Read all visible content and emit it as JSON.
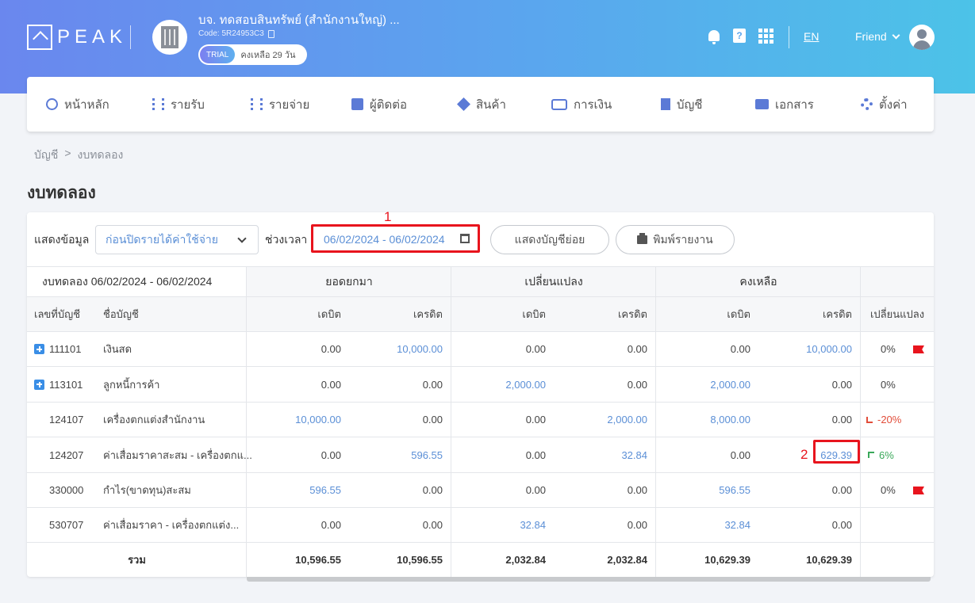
{
  "header": {
    "logo_text": "PEAK",
    "company_name": "บจ. ทดสอบสินทรัพย์ (สำนักงานใหญ่) ...",
    "company_code": "Code: 5R24953C3",
    "trial_badge": "TRIAL",
    "trial_remaining": "คงเหลือ 29 วัน",
    "language": "EN",
    "user_name": "Friend"
  },
  "nav": {
    "items": [
      {
        "label": "หน้าหลัก",
        "icon": "dashboard-icon"
      },
      {
        "label": "รายรับ",
        "icon": "income-icon"
      },
      {
        "label": "รายจ่าย",
        "icon": "expense-icon"
      },
      {
        "label": "ผู้ติดต่อ",
        "icon": "contact-icon"
      },
      {
        "label": "สินค้า",
        "icon": "product-icon"
      },
      {
        "label": "การเงิน",
        "icon": "money-icon"
      },
      {
        "label": "บัญชี",
        "icon": "account-book-icon"
      },
      {
        "label": "เอกสาร",
        "icon": "folder-icon"
      },
      {
        "label": "ตั้งค่า",
        "icon": "gear-icon"
      }
    ]
  },
  "breadcrumb": {
    "parent": "บัญชี",
    "separator": ">",
    "current": "งบทดลอง"
  },
  "page_title": "งบทดลอง",
  "filters": {
    "display_label": "แสดงข้อมูล",
    "display_value": "ก่อนปิดรายได้ค่าใช้จ่าย",
    "period_label": "ช่วงเวลา",
    "period_value": "06/02/2024 - 06/02/2024",
    "show_sub_accounts": "แสดงบัญชีย่อย",
    "print_report": "พิมพ์รายงาน"
  },
  "annotations": {
    "marker1": "1",
    "marker2": "2"
  },
  "table": {
    "title": "งบทดลอง 06/02/2024 - 06/02/2024",
    "groups": [
      "ยอดยกมา",
      "เปลี่ยนแปลง",
      "คงเหลือ"
    ],
    "col_account_no": "เลขที่บัญชี",
    "col_account_name": "ชื่อบัญชี",
    "col_debit": "เดบิต",
    "col_credit": "เครดิต",
    "col_change": "เปลี่ยนแปลง",
    "rows": [
      {
        "no": "111101",
        "name": "เงินสด",
        "ob_dr": "0.00",
        "ob_cr": "10,000.00",
        "ch_dr": "0.00",
        "ch_cr": "0.00",
        "cb_dr": "0.00",
        "cb_cr": "10,000.00",
        "pct": "0%"
      },
      {
        "no": "113101",
        "name": "ลูกหนี้การค้า",
        "ob_dr": "0.00",
        "ob_cr": "0.00",
        "ch_dr": "2,000.00",
        "ch_cr": "0.00",
        "cb_dr": "2,000.00",
        "cb_cr": "0.00",
        "pct": "0%"
      },
      {
        "no": "124107",
        "name": "เครื่องตกแต่งสำนักงาน",
        "ob_dr": "10,000.00",
        "ob_cr": "0.00",
        "ch_dr": "0.00",
        "ch_cr": "2,000.00",
        "cb_dr": "8,000.00",
        "cb_cr": "0.00",
        "pct": "-20%"
      },
      {
        "no": "124207",
        "name": "ค่าเสื่อมราคาสะสม - เครื่องตกแ...",
        "ob_dr": "0.00",
        "ob_cr": "596.55",
        "ch_dr": "0.00",
        "ch_cr": "32.84",
        "cb_dr": "0.00",
        "cb_cr": "629.39",
        "pct": "6%"
      },
      {
        "no": "330000",
        "name": "กำไร(ขาดทุน)สะสม",
        "ob_dr": "596.55",
        "ob_cr": "0.00",
        "ch_dr": "0.00",
        "ch_cr": "0.00",
        "cb_dr": "596.55",
        "cb_cr": "0.00",
        "pct": "0%"
      },
      {
        "no": "530707",
        "name": "ค่าเสื่อมราคา - เครื่องตกแต่ง...",
        "ob_dr": "0.00",
        "ob_cr": "0.00",
        "ch_dr": "32.84",
        "ch_cr": "0.00",
        "cb_dr": "32.84",
        "cb_cr": "0.00",
        "pct": ""
      }
    ],
    "total": {
      "label": "รวม",
      "ob_dr": "10,596.55",
      "ob_cr": "10,596.55",
      "ch_dr": "2,032.84",
      "ch_cr": "2,032.84",
      "cb_dr": "10,629.39",
      "cb_cr": "10,629.39"
    }
  },
  "colors": {
    "accent": "#5b8fd6",
    "highlight": "#e8141d",
    "negative": "#e24d3a",
    "positive": "#3aa85a"
  }
}
